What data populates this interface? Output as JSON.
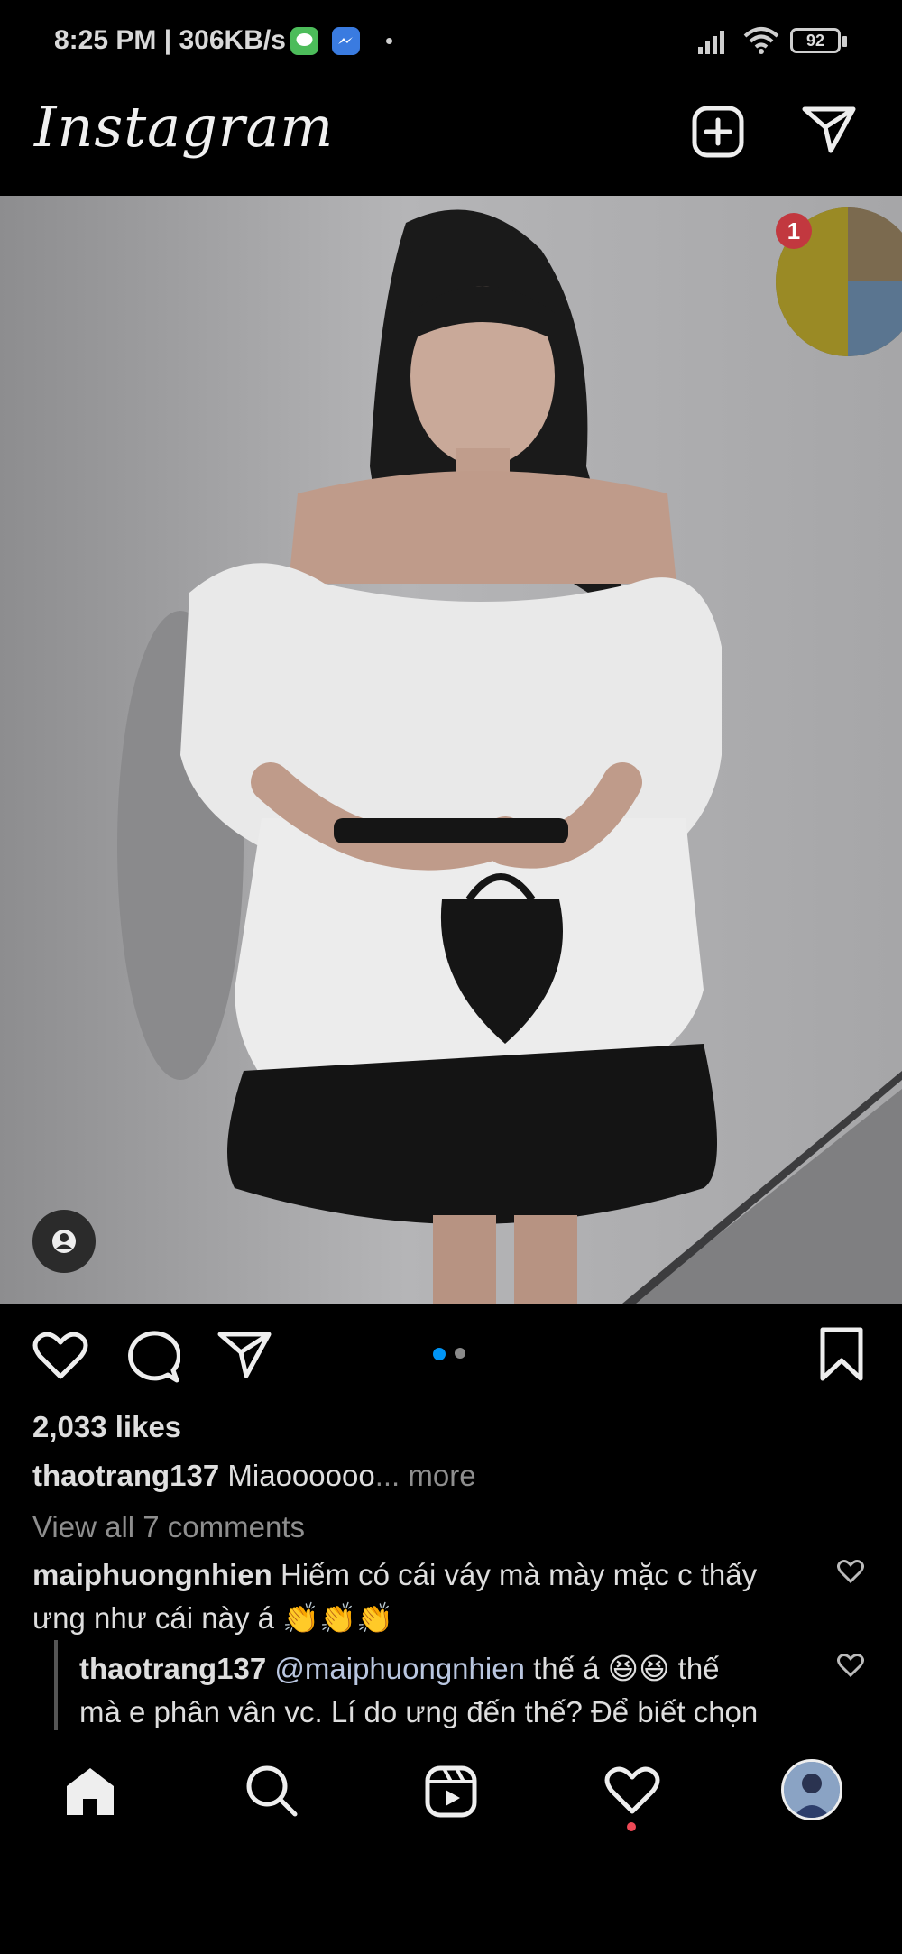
{
  "status_bar": {
    "time": "8:25 PM",
    "speed": "306KB/s",
    "battery": "92",
    "icons": [
      "message-app-icon",
      "messenger-icon",
      "dot-icon",
      "signal-icon",
      "wifi-icon",
      "battery-icon"
    ]
  },
  "header": {
    "logo": "Instagram",
    "icons": [
      "new-post-icon",
      "direct-message-icon"
    ]
  },
  "story_bubble": {
    "badge": "1"
  },
  "post": {
    "photo_icons": [
      "tag-user-icon"
    ],
    "carousel": {
      "count": 2,
      "active": 1
    },
    "likes": "2,033 likes",
    "caption": {
      "username": "thaotrang137",
      "text": "Miaoooooo",
      "more": "... more"
    },
    "view_comments": "View all 7 comments",
    "comments": [
      {
        "username": "maiphuongnhien",
        "text_line1": "Hiếm có cái váy mà mày mặc c thấy",
        "text_line2": "ưng như cái này á 👏👏👏"
      }
    ],
    "reply": {
      "username": "thaotrang137",
      "mention": "@maiphuongnhien",
      "text_line1": "thế á 😆😆 thế",
      "text_line2": "mà e phân vân vc. Lí do ưng đến thế? Để biết chọn"
    }
  },
  "nav": {
    "items": [
      "home-icon",
      "search-icon",
      "reels-icon",
      "activity-icon",
      "profile-avatar"
    ],
    "activity_dot_color": "#ed4956"
  },
  "colors": {
    "accent": "#0095f6",
    "badge": "#ed4956",
    "background": "#000000"
  }
}
